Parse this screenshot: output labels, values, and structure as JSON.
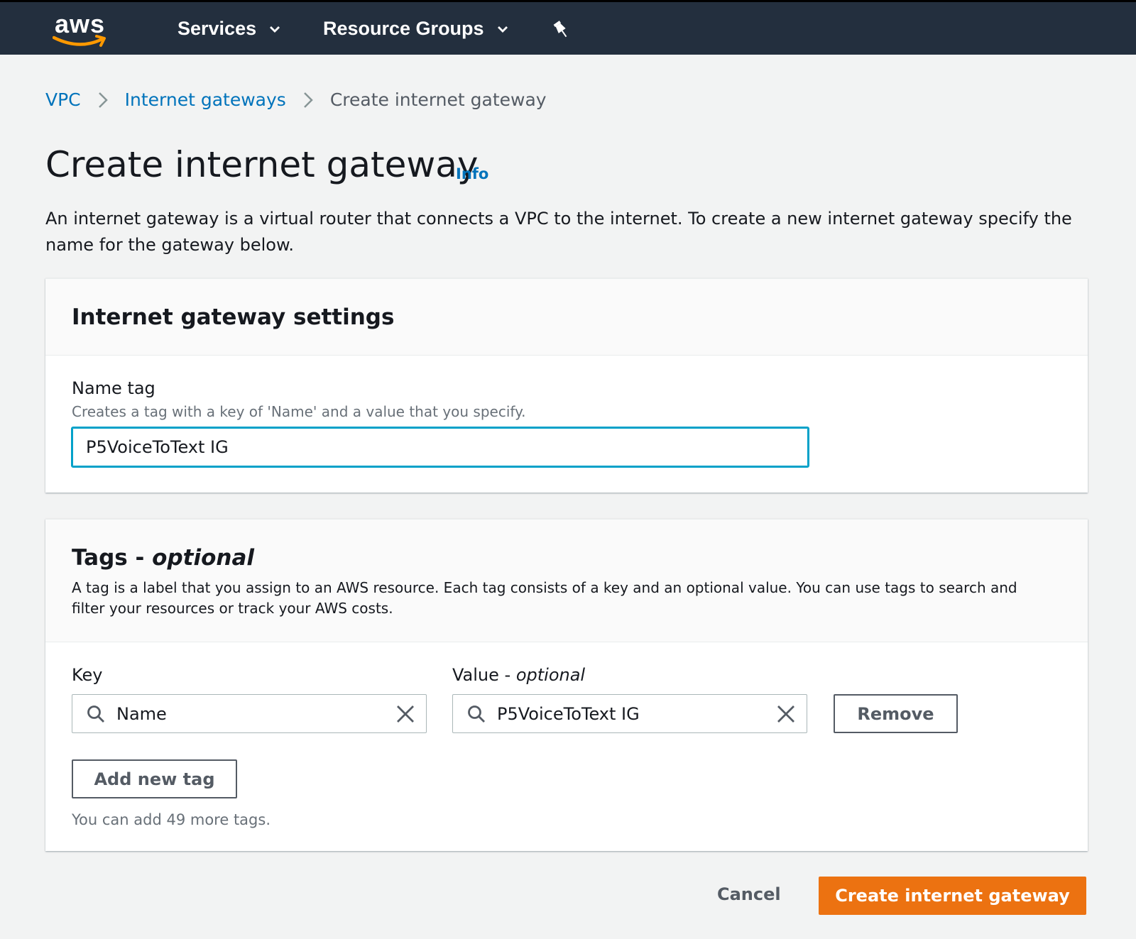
{
  "topbar": {
    "logo_text": "aws",
    "services_label": "Services",
    "resource_groups_label": "Resource Groups",
    "bg_color": "#232f3e"
  },
  "breadcrumb": {
    "items": [
      "VPC",
      "Internet gateways"
    ],
    "current": "Create internet gateway"
  },
  "page": {
    "title": "Create internet gateway",
    "info_link": "Info",
    "description": "An internet gateway is a virtual router that connects a VPC to the internet. To create a new internet gateway specify the name for the gateway below."
  },
  "settings_panel": {
    "title": "Internet gateway settings",
    "name_tag_label": "Name tag",
    "name_tag_description": "Creates a tag with a key of 'Name' and a value that you specify.",
    "name_tag_value": "P5VoiceToText IG"
  },
  "tags_panel": {
    "title": "Tags - ",
    "title_optional": "optional",
    "description": "A tag is a label that you assign to an AWS resource. Each tag consists of a key and an optional value. You can use tags to search and filter your resources or track your AWS costs.",
    "key_label": "Key",
    "value_label": "Value - ",
    "value_label_optional": "optional",
    "tags": [
      {
        "key": "Name",
        "value": "P5VoiceToText IG",
        "remove_label": "Remove"
      }
    ],
    "add_button_label": "Add new tag",
    "remaining_text": "You can add 49 more tags."
  },
  "footer": {
    "cancel_label": "Cancel",
    "submit_label": "Create internet gateway",
    "submit_color": "#ec7211"
  },
  "icons": [
    "aws-logo",
    "chevron-down-icon",
    "pin-icon",
    "chevron-right-icon",
    "search-icon",
    "close-icon"
  ]
}
